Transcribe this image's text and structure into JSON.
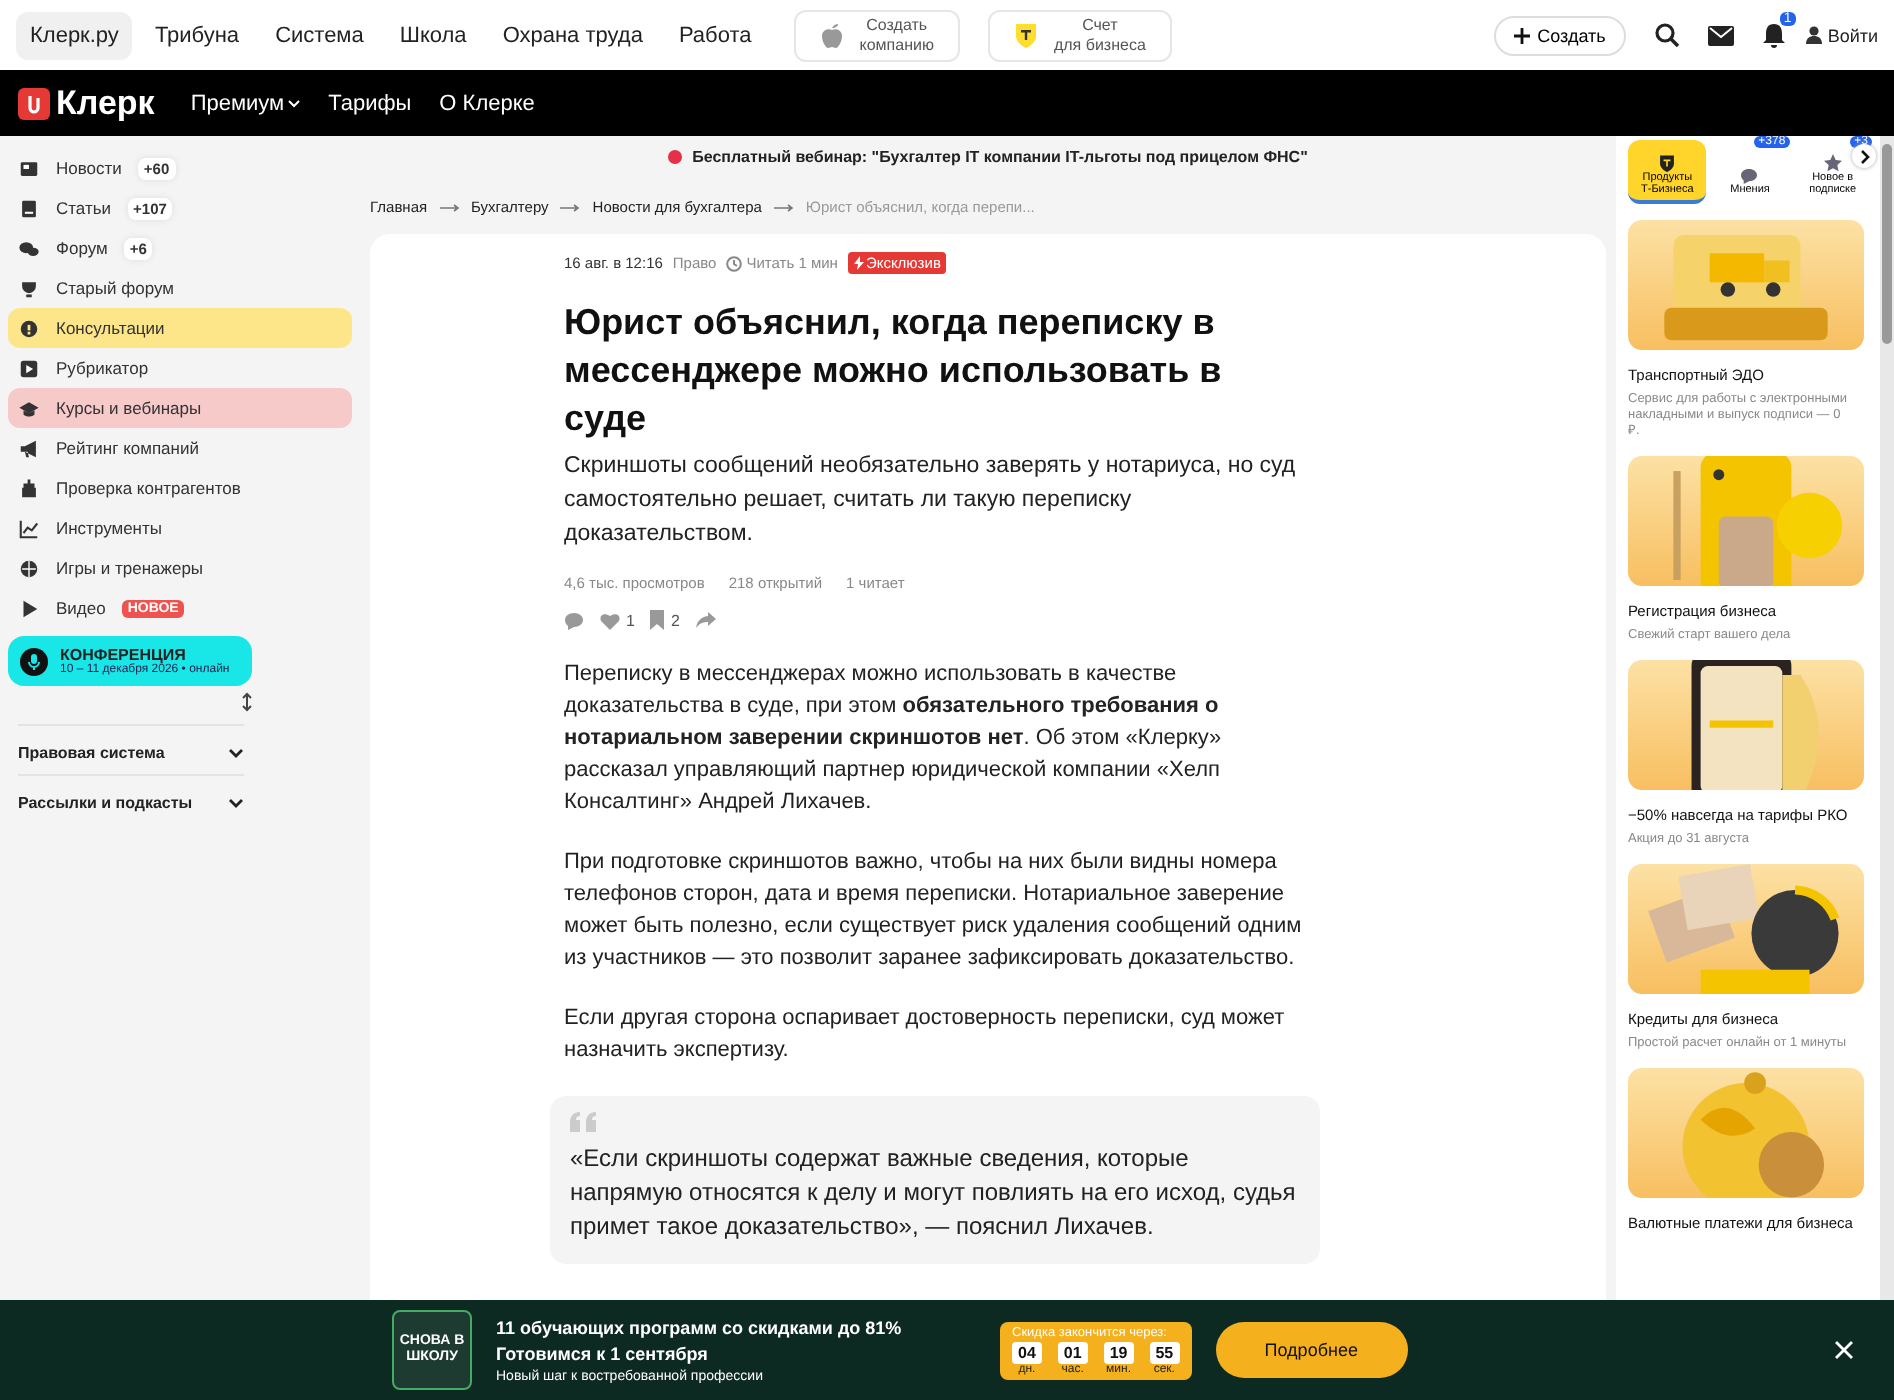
{
  "top_nav": {
    "links": [
      {
        "label": "Клерк.ру",
        "selected": true
      },
      {
        "label": "Трибуна",
        "selected": false
      },
      {
        "label": "Система",
        "selected": false
      },
      {
        "label": "Школа",
        "selected": false
      },
      {
        "label": "Охрана труда",
        "selected": false
      },
      {
        "label": "Работа",
        "selected": false
      }
    ],
    "promos": [
      {
        "kind": "apple",
        "lines": [
          "Создать",
          "компанию"
        ]
      },
      {
        "kind": "shield",
        "lines": [
          "Счет",
          "для бизнеса"
        ]
      }
    ],
    "create_button": "Создать",
    "notifications_badge": "1",
    "login": "Войти"
  },
  "brand_bar": {
    "logo": "Клерк",
    "links": [
      {
        "label": "Премиум",
        "dropdown": true
      },
      {
        "label": "Тарифы",
        "dropdown": false
      },
      {
        "label": "О Клерке",
        "dropdown": false
      }
    ]
  },
  "sidebar": {
    "items": [
      {
        "label": "Новости",
        "badge": "+60"
      },
      {
        "label": "Статьи",
        "badge": "+107"
      },
      {
        "label": "Форум",
        "badge": "+6"
      },
      {
        "label": "Старый форум"
      },
      {
        "label": "Консультации",
        "color": "#fde68a"
      },
      {
        "label": "Рубрикатор"
      },
      {
        "label": "Курсы и вебинары",
        "color": "#f7caca"
      },
      {
        "label": "Рейтинг компаний"
      },
      {
        "label": "Проверка контрагентов"
      },
      {
        "label": "Инструменты"
      },
      {
        "label": "Игры и тренажеры"
      },
      {
        "label": "Видео",
        "tag": "НОВОЕ"
      }
    ],
    "conference": {
      "title": "КОНФЕРЕНЦИЯ",
      "subtitle": "10 – 11 декабря 2026 • онлайн"
    },
    "sections": [
      {
        "label": "Правовая система",
        "expanded": false
      },
      {
        "label": "Рассылки и подкасты",
        "expanded": false
      }
    ]
  },
  "announcement": "Бесплатный вебинар: \"Бухгалтер IT компании IT-льготы под прицелом ФНС\"",
  "breadcrumbs": [
    "Главная",
    "Бухгалтеру",
    "Новости для бухгалтера",
    "Юрист объяснил, когда перепи..."
  ],
  "article": {
    "date": "16 авг. в 12:16",
    "rubric": "Право",
    "read_time": "Читать 1 мин",
    "tag": "Эксклюзив",
    "title": "Юрист объяснил, когда переписку в мессенджере можно использовать в суде",
    "lead": "Скриншоты сообщений необязательно заверять у нотариуса, но суд самостоятельно решает, считать ли такую переписку доказательством.",
    "stats": [
      "4,6 тыс. просмотров",
      "218 открытий",
      "1 читает"
    ],
    "likes": "1",
    "bookmarks": "2",
    "paragraphs": [
      "Переписку в мессенджерах можно использовать в качестве доказательства в суде, при этом **обязательного требования о нотариальном заверении скриншотов нет**. Об этом «Клерку» рассказал управляющий партнер юридической компании «Хелп Консалтинг» Андрей Лихачев.",
      "При подготовке скриншотов важно, чтобы на них были видны номера телефонов сторон, дата и время переписки. Нотариальное заверение может быть полезно, если существует риск удаления сообщений одним из участников — это позволит заранее зафиксировать доказательство.",
      "Если другая сторона оспаривает достоверность переписки, суд может назначить экспертизу."
    ],
    "quote": "«Если скриншоты содержат важные сведения, которые напрямую относятся к делу и могут повлиять на его исход, судья примет такое доказательство», — пояснил Лихачев."
  },
  "right_panel": {
    "tabs": [
      {
        "label": "Продукты Т-Бизнеса",
        "selected": true
      },
      {
        "label": "Мнения",
        "badge": "+378",
        "selected": false
      },
      {
        "label": "Новое в подписке",
        "badge": "+3",
        "selected": false
      }
    ],
    "cards": [
      {
        "title": "Транспортный ЭДО",
        "text": "Сервис для работы с электронными накладными и выпуск подписи — 0 ₽."
      },
      {
        "title": "Регистрация бизнеса",
        "text": "Свежий старт вашего дела"
      },
      {
        "title": "−50% навсегда на тарифы РКО",
        "text": "Акция до 31 августа"
      },
      {
        "title": "Кредиты для бизнеса",
        "text": "Простой расчет онлайн от 1 минуты"
      },
      {
        "title": "Валютные платежи для бизнеса"
      }
    ]
  },
  "promo_banner": {
    "logo": "СНОВА В ШКОЛУ",
    "title": "11 обучающих программ со скидками до 81%",
    "subtitle": "Готовимся к 1 сентября",
    "note": "Новый шаг к востребованной профессии",
    "timer_label": "Скидка закончится через:",
    "timer": [
      {
        "value": "04",
        "unit": "дн."
      },
      {
        "value": "01",
        "unit": "час."
      },
      {
        "value": "19",
        "unit": "мин."
      },
      {
        "value": "55",
        "unit": "сек."
      }
    ],
    "button": "Подробнее"
  }
}
